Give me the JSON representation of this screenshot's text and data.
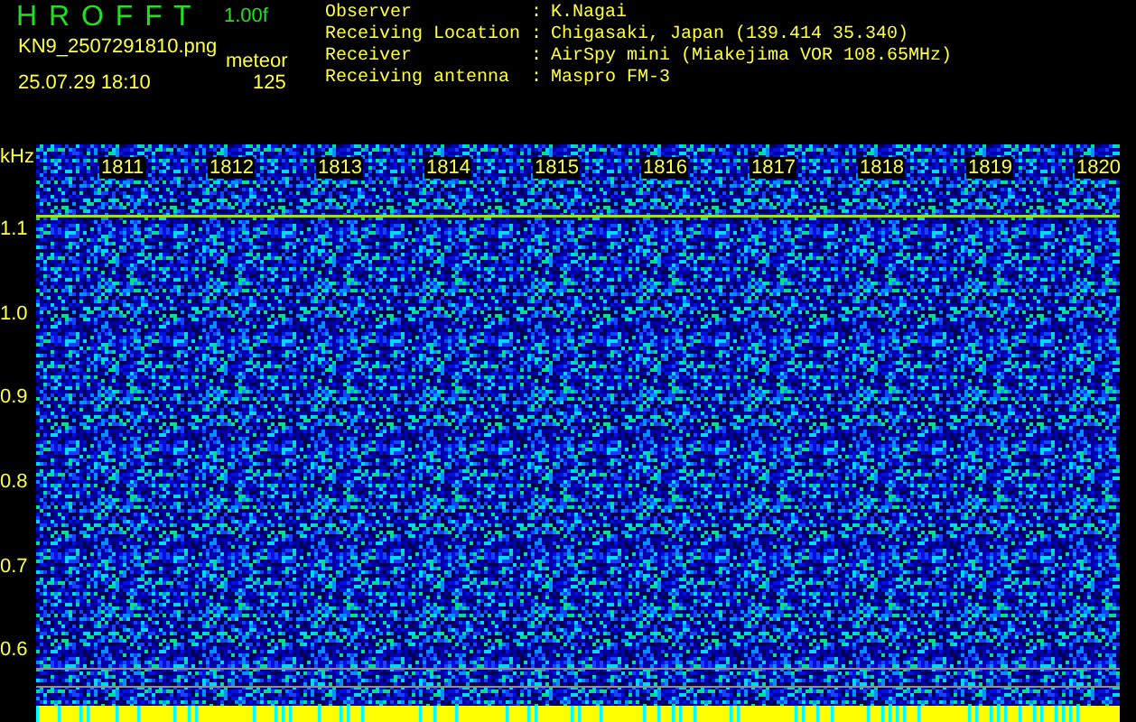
{
  "header": {
    "title": "H R O F F T",
    "version": "1.00f",
    "filename": "KN9_2507291810.png",
    "mode": "meteor",
    "datetime": "25.07.29 18:10",
    "count": "125"
  },
  "info": [
    {
      "label": "Observer",
      "separator": ":",
      "value": "K.Nagai"
    },
    {
      "label": "Receiving Location",
      "separator": ":",
      "value": "Chigasaki, Japan (139.414 35.340)"
    },
    {
      "label": "Receiver",
      "separator": ":",
      "value": "AirSpy mini (Miakejima VOR 108.65MHz)"
    },
    {
      "label": "Receiving antenna",
      "separator": ":",
      "value": "Maspro FM-3"
    }
  ],
  "y_axis": {
    "unit": "kHz",
    "labels": [
      "1.1",
      "1.0",
      "0.9",
      "0.8",
      "0.7",
      "0.6"
    ]
  },
  "time_labels": [
    "1811",
    "1812",
    "1813",
    "1814",
    "1815",
    "1816",
    "1817",
    "1818",
    "1819",
    "1820"
  ]
}
